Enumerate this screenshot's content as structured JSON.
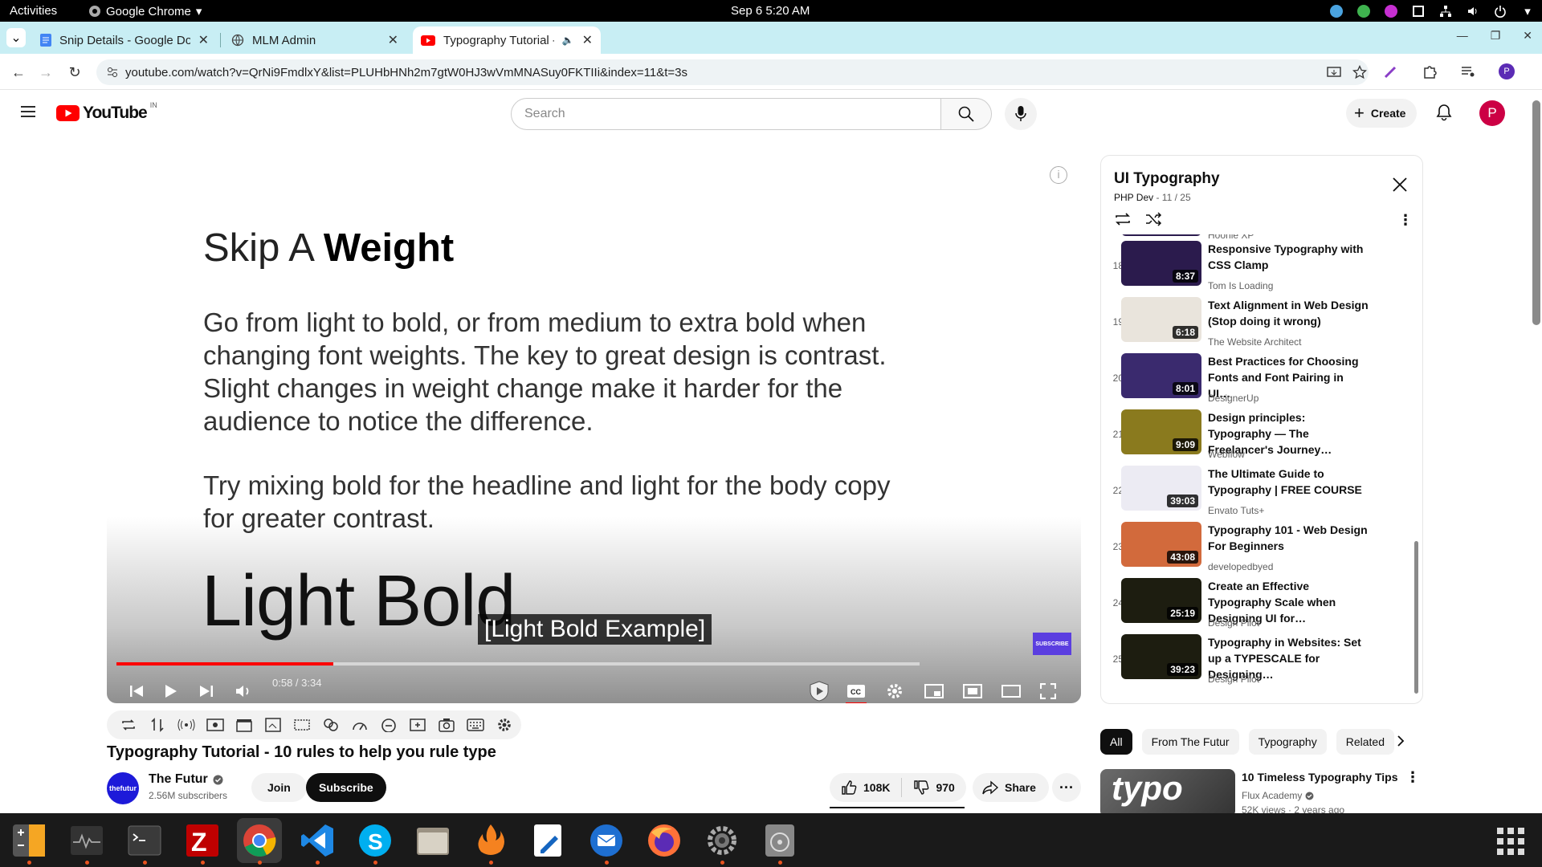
{
  "system": {
    "activities": "Activities",
    "app_name": "Google Chrome",
    "clock": "Sep 6  5:20 AM"
  },
  "browser": {
    "tabs": [
      {
        "title": "Snip Details - Google Do"
      },
      {
        "title": "MLM Admin"
      },
      {
        "title": "Typography Tutorial -"
      }
    ],
    "url": "youtube.com/watch?v=QrNi9FmdlxY&list=PLUHbHNh2m7gtW0HJ3wVmMNASuy0FKTIIi&index=11&t=3s",
    "avatar_letter": "P"
  },
  "youtube": {
    "wordmark": "YouTube",
    "country": "IN",
    "search_placeholder": "Search",
    "create_label": "Create",
    "avatar_letter": "P"
  },
  "player": {
    "slide_heading_light": "Skip A ",
    "slide_heading_bold": "Weight",
    "slide_para1": "Go from light to bold, or from medium to extra bold when changing font weights. The key to great design is contrast. Slight changes in weight change make it harder for the audience to notice the difference.",
    "slide_para2": "Try mixing bold for the headline and light for the body copy for greater contrast.",
    "demo_text": "Light  Bold",
    "caption": "[Light Bold Example]",
    "subscribe_logo": "SUBSCRIBE",
    "time_display": "0:58 / 3:34",
    "progress_fraction": 0.27
  },
  "video": {
    "title": "Typography Tutorial - 10 rules to help you rule type",
    "channel": "The Futur",
    "channel_avatar_text": "thefutur",
    "subscribers": "2.56M subscribers",
    "join_label": "Join",
    "subscribe_label": "Subscribe",
    "likes": "108K",
    "dislikes": "970",
    "share_label": "Share"
  },
  "playlist": {
    "title": "UI Typography",
    "owner": "PHP Dev",
    "position": " - 11 / 25",
    "partial_channel": "Hoonie XP",
    "items": [
      {
        "index": "18",
        "title": "Responsive Typography with CSS Clamp",
        "channel": "Tom Is Loading",
        "duration": "8:37",
        "thumb": "#2b1b4d"
      },
      {
        "index": "19",
        "title": "Text Alignment in Web Design (Stop doing it wrong)",
        "channel": "The Website Architect",
        "duration": "6:18",
        "thumb": "#e9e4dc"
      },
      {
        "index": "20",
        "title": "Best Practices for Choosing Fonts and Font Pairing in UI…",
        "channel": "DesignerUp",
        "duration": "8:01",
        "thumb": "#3a2a6e"
      },
      {
        "index": "21",
        "title": "Design principles: Typography — The Freelancer's Journey…",
        "channel": "Webflow",
        "duration": "9:09",
        "thumb": "#8a7a1e"
      },
      {
        "index": "22",
        "title": "The Ultimate Guide to Typography | FREE COURSE",
        "channel": "Envato Tuts+",
        "duration": "39:03",
        "thumb": "#ecebf3"
      },
      {
        "index": "23",
        "title": "Typography 101 - Web Design For Beginners",
        "channel": "developedbyed",
        "duration": "43:08",
        "thumb": "#d26a3c"
      },
      {
        "index": "24",
        "title": "Create an Effective Typography Scale when Designing UI for…",
        "channel": "Design Pilot",
        "duration": "25:19",
        "thumb": "#1d1d10"
      },
      {
        "index": "25",
        "title": "Typography in Websites: Set up a TYPESCALE for Designing…",
        "channel": "Design Pilot",
        "duration": "39:23",
        "thumb": "#1d1d10"
      }
    ]
  },
  "chips": [
    "All",
    "From The Futur",
    "Typography",
    "Related"
  ],
  "recommendation": {
    "thumb_text": "typo",
    "title": "10 Timeless Typography Tips",
    "channel": "Flux Academy",
    "meta": "52K views · 2 years ago"
  },
  "colors": {
    "yt_red": "#ff0000",
    "tab_strip": "#c8eef4",
    "avatar": "#cc0044"
  }
}
